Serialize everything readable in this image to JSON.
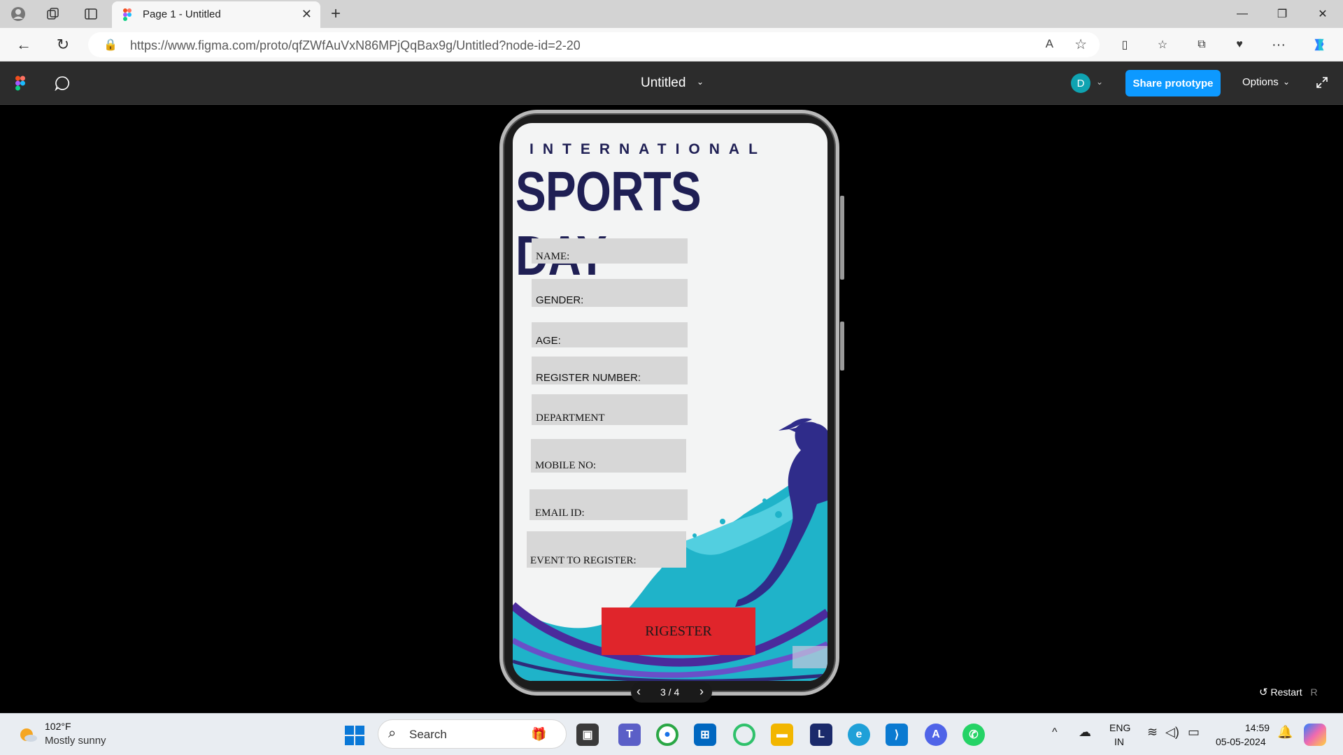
{
  "browser": {
    "tab_title": "Page 1 - Untitled",
    "url": "https://www.figma.com/proto/qfZWfAuVxN86MPjQqBax9g/Untitled?node-id=2-20"
  },
  "figma": {
    "title": "Untitled",
    "avatar_initial": "D",
    "share_label": "Share prototype",
    "options_label": "Options"
  },
  "screen": {
    "heading_top": "INTERNATIONAL",
    "heading_main": "SPORTS DAY",
    "fields": {
      "name": "NAME:",
      "gender": "GENDER:",
      "age": "AGE:",
      "register_number": "REGISTER NUMBER:",
      "department": "DEPARTMENT",
      "mobile": "MOBILE NO:",
      "email": "EMAIL ID:",
      "event": "EVENT TO REGISTER:"
    },
    "register_button": "RIGESTER"
  },
  "navigator": {
    "page": "3 / 4",
    "restart": "Restart",
    "restart_key": "R"
  },
  "taskbar": {
    "temp": "102°F",
    "weather": "Mostly sunny",
    "search": "Search",
    "lang1": "ENG",
    "lang2": "IN",
    "time": "14:59",
    "date": "05-05-2024"
  }
}
